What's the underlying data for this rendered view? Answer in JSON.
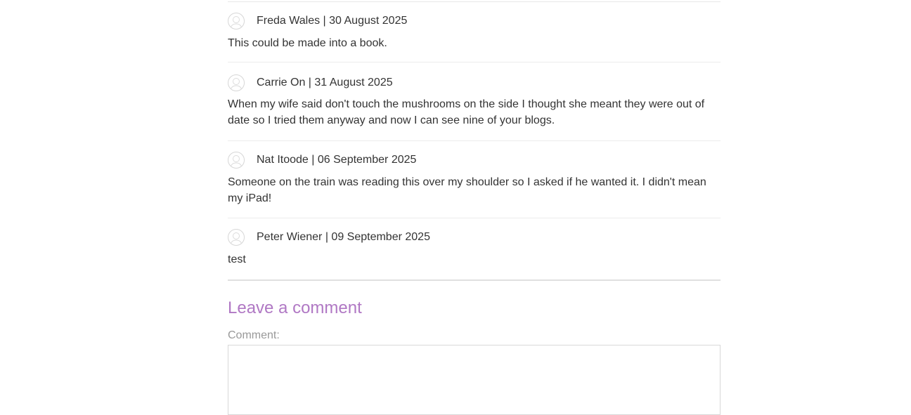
{
  "comments": [
    {
      "author": "Freda Wales",
      "date": "30 August 2025",
      "meta": "Freda Wales | 30 August 2025",
      "body": "This could be made into a book."
    },
    {
      "author": "Carrie On",
      "date": "31 August 2025",
      "meta": "Carrie On | 31 August 2025",
      "body": "When my wife said don't touch the mushrooms on the side I thought she meant they were out of date so I tried them anyway and now I can see nine of your blogs."
    },
    {
      "author": "Nat Itoode",
      "date": "06 September 2025",
      "meta": "Nat Itoode | 06 September 2025",
      "body": "Someone on the train was reading this over my shoulder so I asked if he wanted it. I didn't mean my iPad!"
    },
    {
      "author": "Peter Wiener",
      "date": "09 September 2025",
      "meta": "Peter Wiener | 09 September 2025",
      "body": "test"
    }
  ],
  "leave_comment": {
    "heading": "Leave a comment",
    "comment_label": "Comment:",
    "comment_value": ""
  },
  "icons": {
    "avatar": "user-avatar-icon"
  },
  "colors": {
    "heading_accent": "#b078c4",
    "label_gray": "#999999",
    "text": "#333333",
    "divider": "#ececec"
  }
}
